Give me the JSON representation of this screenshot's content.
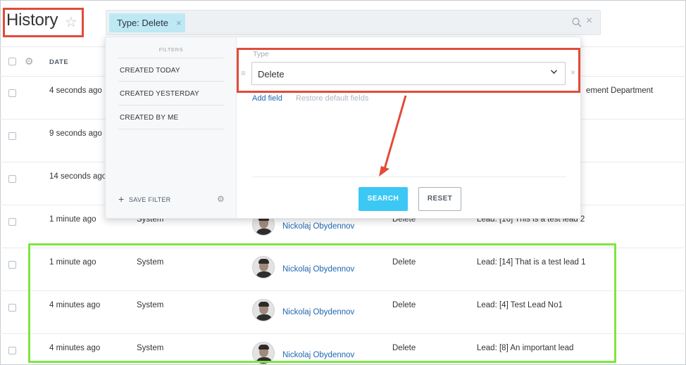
{
  "header": {
    "title": "History",
    "star_icon": "star-outline-icon",
    "search": {
      "chip_label": "Type: Delete",
      "chip_remove": "×",
      "search_icon": "magnifier-icon",
      "clear": "×"
    }
  },
  "table": {
    "columns": [
      "DATE"
    ],
    "rows": [
      {
        "date": "4 seconds ago",
        "source": "",
        "user": "",
        "action": "",
        "entity": "ement Department"
      },
      {
        "date": "9 seconds ago",
        "source": "",
        "user": "",
        "action": "",
        "entity": ""
      },
      {
        "date": "14 seconds ago",
        "source": "",
        "user": "",
        "action": "",
        "entity": ""
      },
      {
        "date": "1 minute ago",
        "source": "System",
        "user": "Nickolaj Obydennov",
        "action": "Delete",
        "entity": "Lead: [16] This is a test lead 2"
      },
      {
        "date": "1 minute ago",
        "source": "System",
        "user": "Nickolaj Obydennov",
        "action": "Delete",
        "entity": "Lead: [14] That is a test lead 1"
      },
      {
        "date": "4 minutes ago",
        "source": "System",
        "user": "Nickolaj Obydennov",
        "action": "Delete",
        "entity": "Lead: [4] Test Lead No1"
      },
      {
        "date": "4 minutes ago",
        "source": "System",
        "user": "Nickolaj Obydennov",
        "action": "Delete",
        "entity": "Lead: [8] An important lead"
      }
    ]
  },
  "filter_popup": {
    "presets_heading": "FILTERS",
    "presets": [
      "CREATED TODAY",
      "CREATED YESTERDAY",
      "CREATED BY ME"
    ],
    "save_filter": "SAVE FILTER",
    "field_label": "Type",
    "field_value": "Delete",
    "field_remove": "×",
    "add_field": "Add field",
    "restore_defaults": "Restore default fields",
    "search_button": "SEARCH",
    "reset_button": "RESET"
  },
  "colors": {
    "highlight_red": "#e24b38",
    "highlight_green": "#7de642",
    "accent_blue": "#3bc8f5",
    "link_blue": "#2067b0"
  }
}
